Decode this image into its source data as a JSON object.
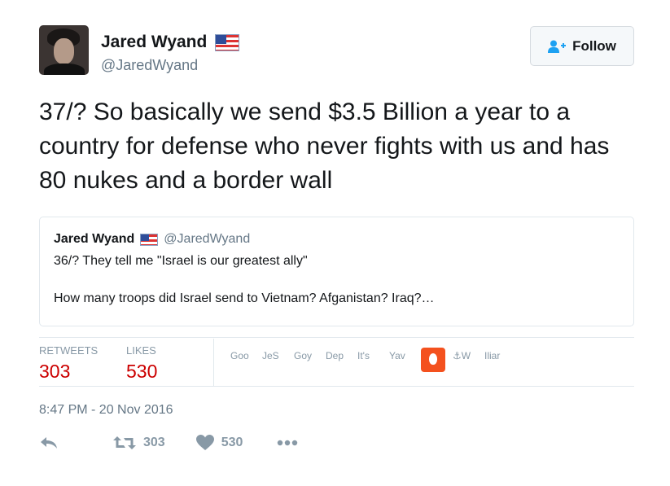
{
  "author": {
    "name": "Jared Wyand",
    "handle": "@JaredWyand",
    "flag_icon": "us-flag-icon"
  },
  "follow_button": {
    "label": "Follow",
    "icon": "add-user-icon"
  },
  "tweet": {
    "text": "37/? So basically we send $3.5 Billion a year to a country for defense who never fights with us and has 80 nukes and a border wall"
  },
  "quoted_tweet": {
    "name": "Jared Wyand",
    "handle": "@JaredWyand",
    "line1": "36/? They tell me \"Israel is our greatest ally\"",
    "line2": "How many troops did Israel send to Vietnam? Afganistan? Iraq?…"
  },
  "stats": {
    "retweets_label": "RETWEETS",
    "retweets_value": "303",
    "likes_label": "LIKES",
    "likes_value": "530"
  },
  "likers": [
    "Goo",
    "JeS",
    "Goy",
    "Dep",
    "It's",
    "Yav",
    "",
    "⚓W",
    "Iliar"
  ],
  "timestamp": "8:47 PM - 20 Nov 2016",
  "actions": {
    "retweet_count": "303",
    "like_count": "530"
  },
  "colors": {
    "accent": "#1da1f2",
    "count_red": "#cc0000",
    "muted": "#8899a6"
  }
}
